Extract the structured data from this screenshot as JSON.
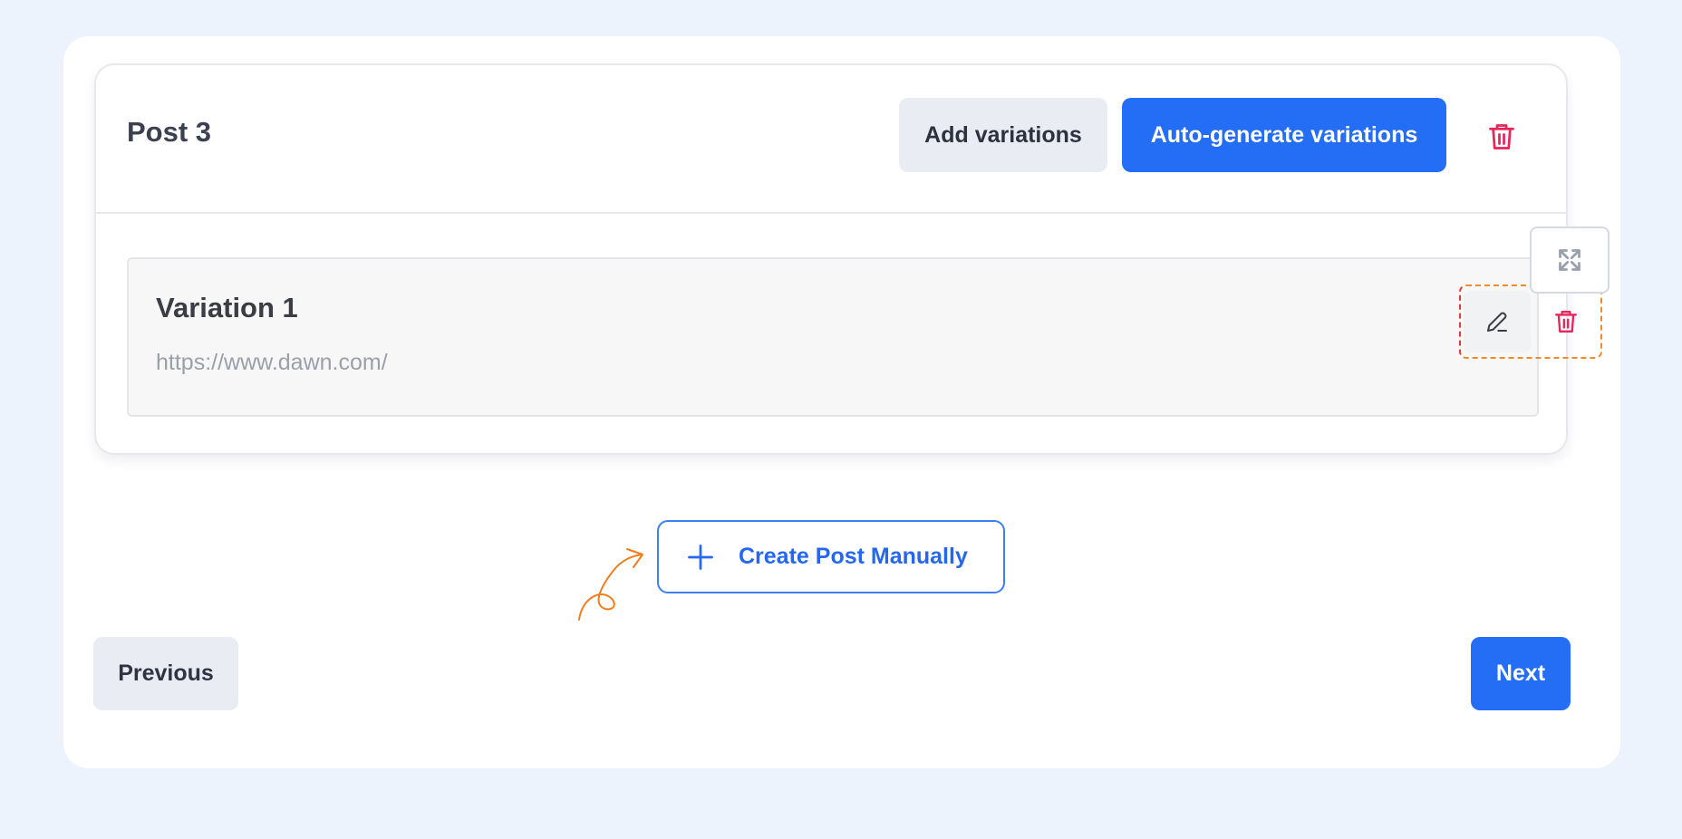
{
  "post": {
    "title": "Post 3",
    "add_variations_label": "Add variations",
    "auto_generate_label": "Auto-generate variations"
  },
  "variation": {
    "title": "Variation 1",
    "url": "https://www.dawn.com/"
  },
  "create_post_label": "Create Post Manually",
  "footer": {
    "previous_label": "Previous",
    "next_label": "Next"
  },
  "icons": {
    "header_delete": "trash-icon",
    "variation_edit": "pencil-icon",
    "variation_delete": "trash-icon",
    "expand": "expand-arrows-icon",
    "create": "plus-icon",
    "doodle": "curly-arrow-icon"
  },
  "colors": {
    "page_background": "#edf3fd",
    "primary": "#246df5",
    "danger": "#e8265b",
    "doodle": "#f07d1e"
  }
}
